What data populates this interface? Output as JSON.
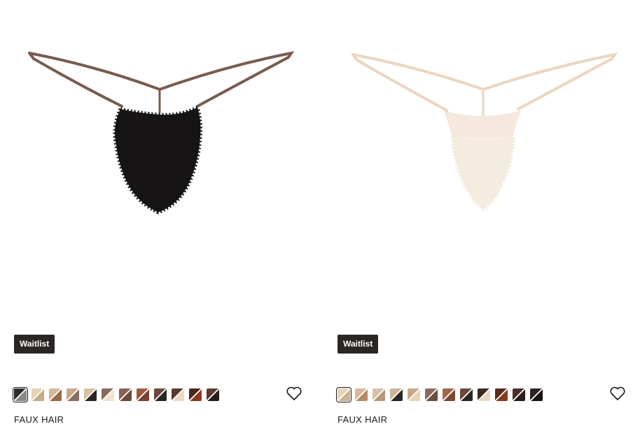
{
  "products": [
    {
      "badge": "Waitlist",
      "name": "FAUX HAIR",
      "hair_color": "#161414",
      "strap_color": "#7a5b4e",
      "swatches": [
        {
          "a": "#2f2c2b",
          "b": "#8a8885",
          "selected": true
        },
        {
          "a": "#e6d1b8",
          "b": "#c7aa8a",
          "selected": false
        },
        {
          "a": "#d6b796",
          "b": "#9a6a4c",
          "selected": false
        },
        {
          "a": "#c9a88c",
          "b": "#8b7060",
          "selected": false
        },
        {
          "a": "#d9c0a0",
          "b": "#2a2623",
          "selected": false
        },
        {
          "a": "#8a6a5a",
          "b": "#f0e4d0",
          "selected": false
        },
        {
          "a": "#8a6350",
          "b": "#6b4a3c",
          "selected": false
        },
        {
          "a": "#9c5a3e",
          "b": "#7a4030",
          "selected": false
        },
        {
          "a": "#6b4a3c",
          "b": "#2a2623",
          "selected": false
        },
        {
          "a": "#5a3a2c",
          "b": "#e9d8bf",
          "selected": false
        },
        {
          "a": "#4a2a20",
          "b": "#8a3a20",
          "selected": false
        },
        {
          "a": "#5a3a30",
          "b": "#2a1d18",
          "selected": false
        }
      ]
    },
    {
      "badge": "Waitlist",
      "name": "FAUX HAIR",
      "hair_color": "#f3ecdf",
      "strap_color": "#ecd6bf",
      "swatches": [
        {
          "a": "#e6d3b8",
          "b": "#cbb494",
          "selected": true
        },
        {
          "a": "#d9b898",
          "b": "#b48a68",
          "selected": false
        },
        {
          "a": "#d8c0a8",
          "b": "#b8967a",
          "selected": false
        },
        {
          "a": "#cdb498",
          "b": "#2a2623",
          "selected": false
        },
        {
          "a": "#c8a888",
          "b": "#e6d3b8",
          "selected": false
        },
        {
          "a": "#8a6a5a",
          "b": "#6b4e42",
          "selected": false
        },
        {
          "a": "#a0664a",
          "b": "#7a4a34",
          "selected": false
        },
        {
          "a": "#6b4a3c",
          "b": "#2a2623",
          "selected": false
        },
        {
          "a": "#3a2a22",
          "b": "#e9d8bf",
          "selected": false
        },
        {
          "a": "#5a2a1c",
          "b": "#8a3a20",
          "selected": false
        },
        {
          "a": "#4a3028",
          "b": "#2a1d18",
          "selected": false
        },
        {
          "a": "#2e2422",
          "b": "#1a1412",
          "selected": false
        }
      ]
    }
  ]
}
